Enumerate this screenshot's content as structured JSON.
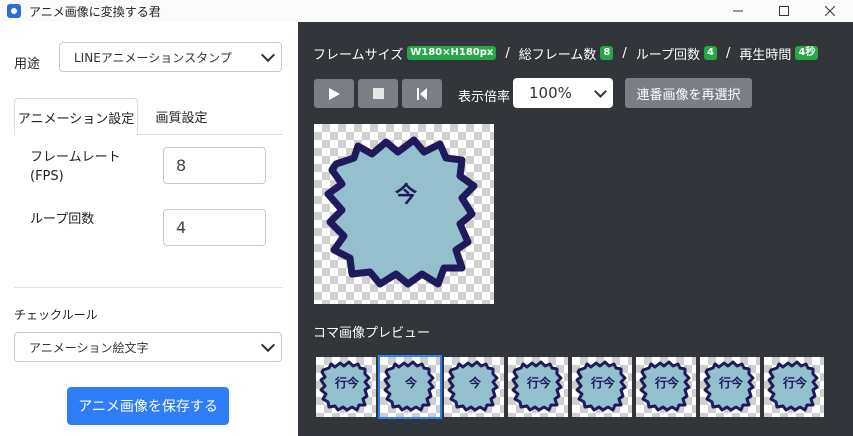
{
  "window": {
    "title": "アニメ画像に変換する君"
  },
  "left": {
    "usage_label": "用途",
    "usage_value": "LINEアニメーションスタンプ",
    "tabs": [
      {
        "label": "アニメーション設定"
      },
      {
        "label": "画質設定"
      }
    ],
    "frame_rate": {
      "label_line1": "フレームレート",
      "label_line2": "(FPS)",
      "value": "8"
    },
    "loop_count": {
      "label": "ループ回数",
      "value": "4"
    },
    "check_rule_label": "チェックルール",
    "check_rule_value": "アニメーション絵文字",
    "save_label": "アニメ画像を保存する"
  },
  "right": {
    "info": {
      "frame_size_label": "フレームサイズ",
      "frame_size_value": "W180×H180px",
      "total_frames_label": "総フレーム数",
      "total_frames_value": "8",
      "loop_label": "ループ回数",
      "loop_value": "4",
      "play_time_label": "再生時間",
      "play_time_value": "4秒",
      "separator": "/"
    },
    "zoom_label": "表示倍率",
    "zoom_value": "100%",
    "reselect_label": "連番画像を再選択",
    "frames_title": "コマ画像プレビュー",
    "preview_glyph": "今",
    "frames": [
      {
        "text": "行今",
        "selected": false
      },
      {
        "text": "今",
        "selected": true
      },
      {
        "text": "今",
        "selected": false
      },
      {
        "text": "行今",
        "selected": false
      },
      {
        "text": "行今",
        "selected": false
      },
      {
        "text": "行今",
        "selected": false
      },
      {
        "text": "行今",
        "selected": false
      },
      {
        "text": "行今",
        "selected": false
      }
    ]
  },
  "colors": {
    "accent": "#2f7ef7",
    "badge": "#26a848",
    "panel_dark": "#32363b",
    "bubble_fill": "#94bfcc",
    "bubble_stroke": "#1e1a5c"
  }
}
